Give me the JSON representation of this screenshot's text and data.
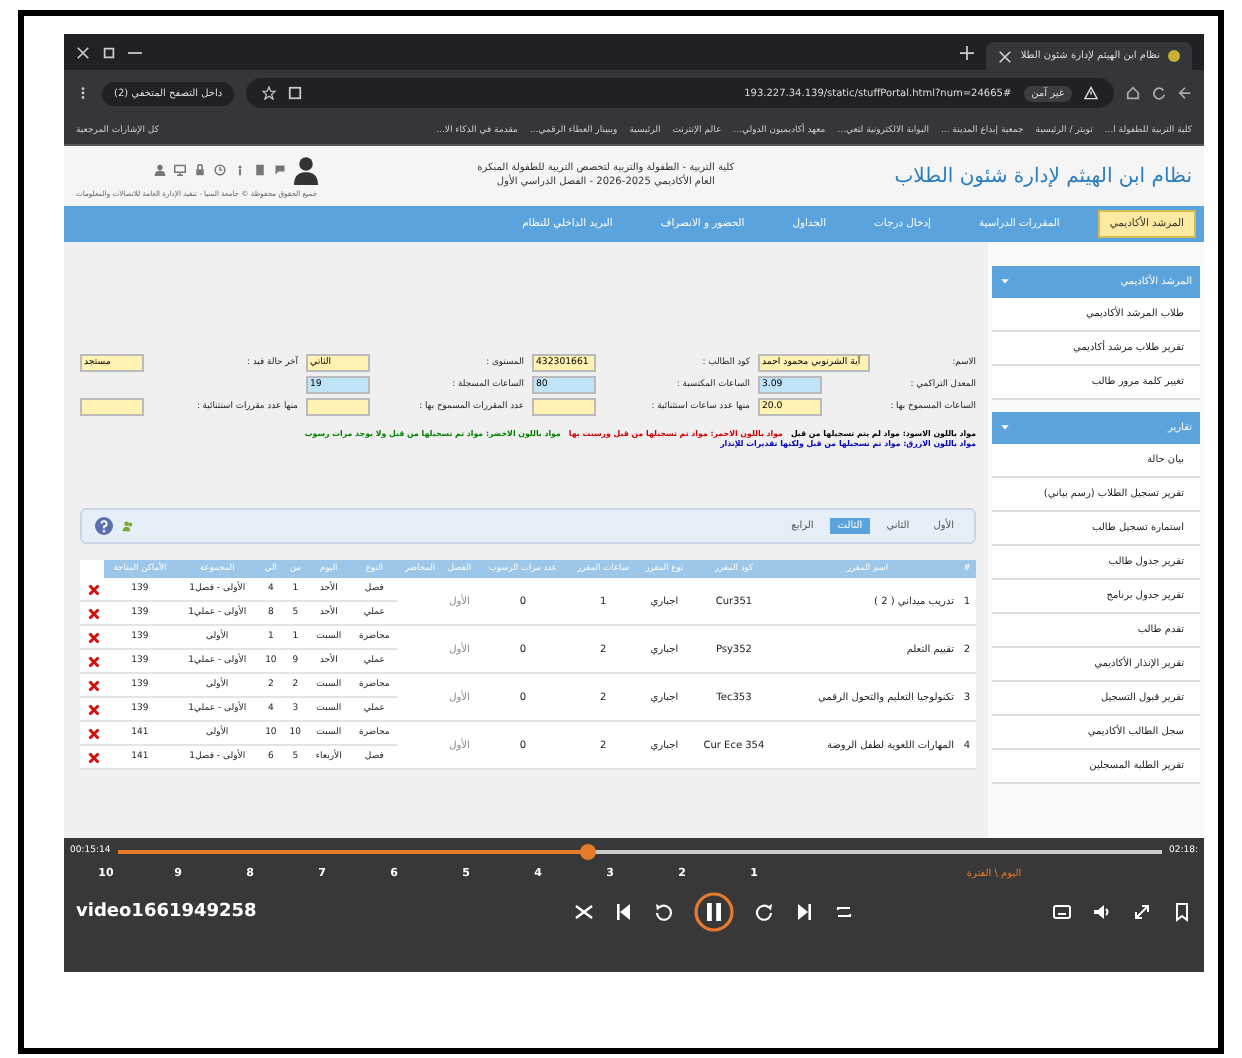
{
  "browser": {
    "tab_title": "نظام ابن الهيثم لإدارة شئون الطلا",
    "security": "غير آمن",
    "url": "193.227.34.139/static/stuffPortal.html?num=24665#",
    "profile": "داخل التصفح المتخفي (2)",
    "bookmarks": [
      "كلية التربية للطفولة ا...",
      "تويتر / الرئيسية",
      "جمعية إبداع المدينة ...",
      "البوابة الالكترونية لتعي...",
      "معهد أكاديميون الدولي...",
      "عالم الإنترنت",
      "الرئيسية",
      "ويبينار العطاء الرقمي...",
      "مقدمة في الذكاء الا..."
    ],
    "all_bookmarks": "كل الإشارات المرجعية"
  },
  "header": {
    "title": "نظام ابن الهيثم لإدارة شئون الطلاب",
    "college": "كلية التربية - الطفولة والتربية لتخصص التربية للطفولة المبكرة",
    "term": "العام الأكاديمي 2025-2026 - الفصل الدراسي الأول",
    "copyright": "جميع الحقوق محفوظة © جامعة المنيا - تنفيذ الإدارة العامة للاتصالات والمعلومات"
  },
  "nav": [
    {
      "label": "المرشد الأكاديمي",
      "selected": true
    },
    {
      "label": "المقررات الدراسية",
      "selected": false
    },
    {
      "label": "إدخال درجات",
      "selected": false
    },
    {
      "label": "الجداول",
      "selected": false
    },
    {
      "label": "الحضور و الانصراف",
      "selected": false
    },
    {
      "label": "البريد الداخلي للنظام",
      "selected": false
    }
  ],
  "sidebar": [
    {
      "title": "المرشد الأكاديمي",
      "items": [
        "طلاب المرشد الأكاديمي",
        "تقرير طلاب مرشد أكاديمي",
        "تغيير كلمة مرور طالب"
      ]
    },
    {
      "title": "تقارير",
      "items": [
        "بيان حالة",
        "تقرير تسجيل الطلاب (رسم بياني)",
        "استمارة تسجيل طالب",
        "تقرير جدول طالب",
        "تقرير جدول برنامج",
        "تقدم طالب",
        "تقرير الإنذار الأكاديمي",
        "تقرير قبول التسجيل",
        "سجل الطالب الأكاديمي",
        "تقرير الطلبة المسجلين"
      ]
    }
  ],
  "form": [
    [
      {
        "label": "الاسم:",
        "value": "آية الشرنوبي محمود احمد",
        "color": "#fff2b3"
      },
      {
        "label": "كود الطالب :",
        "value": "432301661",
        "color": "#fff2b3"
      },
      {
        "label": "المستوى :",
        "value": "الثاني",
        "color": "#fff2b3"
      },
      {
        "label": "آخر حالة قيد :",
        "value": "مستجد",
        "color": "#fff2b3"
      }
    ],
    [
      {
        "label": "المعدل التراكمي :",
        "value": "3.09",
        "color": "#bfe4f7"
      },
      {
        "label": "الساعات المكتسبة :",
        "value": "80",
        "color": "#bfe4f7"
      },
      {
        "label": "الساعات المسجلة :",
        "value": "19",
        "color": "#bfe4f7"
      }
    ],
    [
      {
        "label": "الساعات المسموح بها :",
        "value": "20.0",
        "color": "#fff2b3"
      },
      {
        "label": "منها عدد ساعات استثنائية :",
        "color": "#fff2b3"
      },
      {
        "label": "عدد المقررات المسموح بها :",
        "color": "#fff2b3"
      },
      {
        "label": "منها عدد مقررات استثنائية :",
        "color": "#fff2b3"
      }
    ]
  ],
  "legend": [
    [
      {
        "text": "مواد باللون الاسود: مواد لم يتم تسجيلها من قبل",
        "color": "#000000"
      },
      {
        "text": "مواد باللون الاحمر: مواد تم تسجيلها من قبل ورسبت بها",
        "color": "#d00000"
      },
      {
        "text": "مواد باللون الاخضر: مواد تم تسجيلها من قبل ولا يوجد مرات رسوب",
        "color": "#008000"
      }
    ],
    [
      {
        "text": "مواد باللون الازرق: مواد تم تسجيلها من قبل ولكنها تقديرات للإنذار",
        "color": "#0000c0"
      }
    ]
  ],
  "levels": [
    {
      "label": "الأول",
      "selected": false
    },
    {
      "label": "الثاني",
      "selected": false
    },
    {
      "label": "الثالث",
      "selected": true
    },
    {
      "label": "الرابع",
      "selected": false
    }
  ],
  "table": {
    "columns": [
      "#",
      "اسم المقرر",
      "كود المقرر",
      "نوع المقرر",
      "ساعات المقرر",
      "عدد مرات الرسوب",
      "الفصل",
      "المحاضر",
      "النوع",
      "اليوم",
      "من",
      "الي",
      "المجموعة",
      "الأماكن المتاحة"
    ],
    "rows": [
      {
        "num": "1",
        "name": "تدريب ميداني ( 2 )",
        "code": "Cur351",
        "type": "اجباري",
        "hours": "1",
        "fails": "0",
        "term": "الأول",
        "sessions": [
          [
            "فصل",
            "الأحد",
            "1",
            "4",
            "الأولى - فصل1",
            "139"
          ],
          [
            "عملي",
            "الأحد",
            "5",
            "8",
            "الأولى - عملي1",
            "139"
          ]
        ]
      },
      {
        "num": "2",
        "name": "تقييم التعلم",
        "code": "Psy352",
        "type": "اجباري",
        "hours": "2",
        "fails": "0",
        "term": "الأول",
        "sessions": [
          [
            "محاضرة",
            "السبت",
            "1",
            "1",
            "الأولى",
            "139"
          ],
          [
            "عملي",
            "الأحد",
            "9",
            "10",
            "الأولى - عملي1",
            "139"
          ]
        ]
      },
      {
        "num": "3",
        "name": "تكنولوجيا التعليم والتحول الرقمي",
        "code": "Tec353",
        "type": "اجباري",
        "hours": "2",
        "fails": "0",
        "term": "الأول",
        "sessions": [
          [
            "محاضرة",
            "السبت",
            "2",
            "2",
            "الأولى",
            "139"
          ],
          [
            "عملي",
            "السبت",
            "3",
            "4",
            "الأولى - عملي1",
            "139"
          ]
        ]
      },
      {
        "num": "4",
        "name": "المهارات اللغوية لطفل الروضة",
        "code": "Cur Ece 354",
        "type": "اجباري",
        "hours": "2",
        "fails": "0",
        "term": "الأول",
        "sessions": [
          [
            "محاضرة",
            "السبت",
            "10",
            "10",
            "الأولى",
            "141"
          ],
          [
            "فصل",
            "الأربعاء",
            "5",
            "6",
            "الأولى - فصل1",
            "141"
          ]
        ]
      }
    ]
  },
  "video": {
    "title": "video1661949258",
    "elapsed": "00:15:14",
    "total": "02:18:",
    "level": 0.45,
    "periods_label": "اليوم \\ الفترة",
    "periods": [
      "1",
      "2",
      "3",
      "4",
      "5",
      "6",
      "7",
      "8",
      "9",
      "10"
    ]
  }
}
